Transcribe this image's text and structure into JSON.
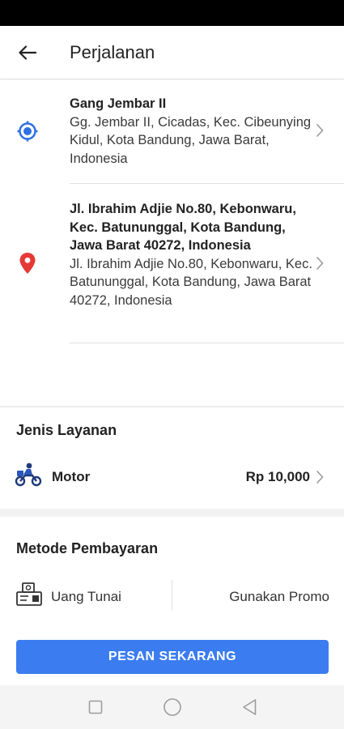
{
  "header": {
    "title": "Perjalanan",
    "back_icon": "arrow-left-icon"
  },
  "route": {
    "origin": {
      "icon": "origin-target-icon",
      "icon_color": "#2f6fe6",
      "title": "Gang Jembar II",
      "address": "Gg. Jembar II, Cicadas, Kec. Cibeunying Kidul, Kota Bandung, Jawa Barat, Indonesia"
    },
    "destination": {
      "icon": "destination-pin-icon",
      "icon_color": "#e53935",
      "title": "Jl. Ibrahim Adjie No.80, Kebonwaru, Kec. Batununggal, Kota Bandung, Jawa Barat 40272, Indonesia",
      "address": "Jl. Ibrahim Adjie No.80, Kebonwaru, Kec. Batununggal, Kota Bandung, Jawa Barat 40272, Indonesia"
    }
  },
  "service": {
    "heading": "Jenis Layanan",
    "icon": "motorcycle-icon",
    "name": "Motor",
    "price": "Rp 10,000"
  },
  "payment": {
    "heading": "Metode Pembayaran",
    "icon": "cash-icon",
    "method": "Uang Tunai",
    "promo": "Gunakan Promo"
  },
  "order_button": {
    "label": "PESAN SEKARANG",
    "color": "#3b7df0"
  },
  "system_nav": {
    "recents_icon": "square-recents-icon",
    "home_icon": "circle-home-icon",
    "back_icon": "triangle-back-icon"
  }
}
